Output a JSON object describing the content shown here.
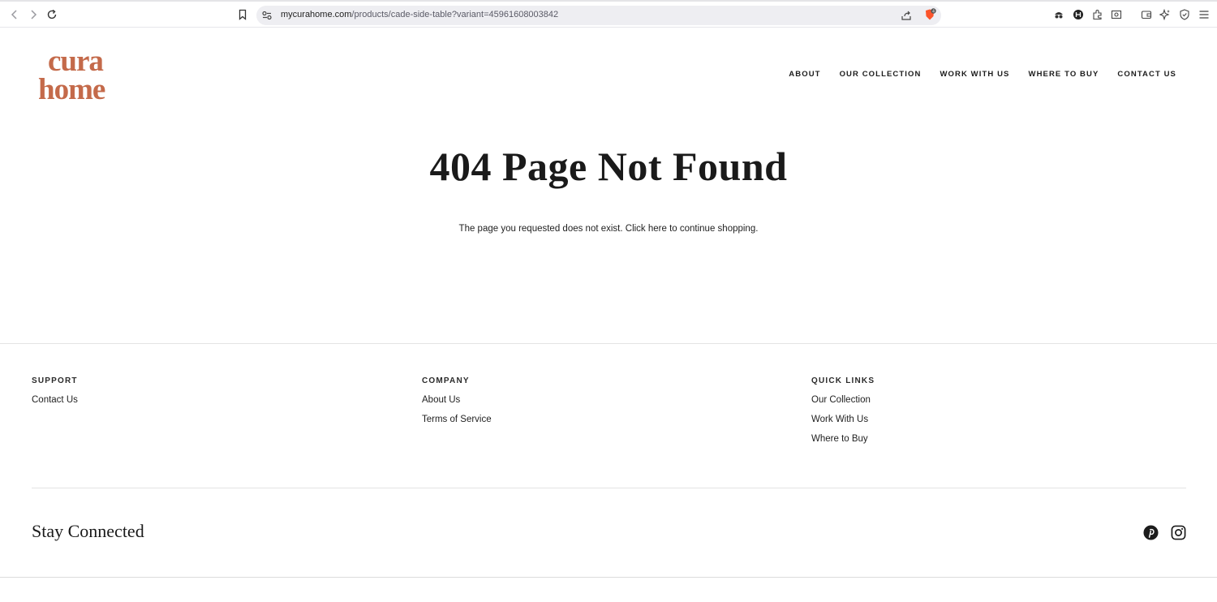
{
  "browser": {
    "url_host": "mycurahome.com",
    "url_path": "/products/cade-side-table?variant=45961608003842",
    "shields_badge": "4"
  },
  "header": {
    "logo_alt": "cura home",
    "nav": [
      "ABOUT",
      "OUR COLLECTION",
      "WORK WITH US",
      "WHERE TO BUY",
      "CONTACT US"
    ]
  },
  "main": {
    "title": "404 Page Not Found",
    "message": "The page you requested does not exist. Click here to continue shopping."
  },
  "footer": {
    "columns": [
      {
        "heading": "SUPPORT",
        "links": [
          "Contact Us"
        ]
      },
      {
        "heading": "COMPANY",
        "links": [
          "About Us",
          "Terms of Service"
        ]
      },
      {
        "heading": "QUICK LINKS",
        "links": [
          "Our Collection",
          "Work With Us",
          "Where to Buy"
        ]
      }
    ],
    "stay_connected": "Stay Connected",
    "social": [
      "pinterest-icon",
      "instagram-icon"
    ]
  },
  "colors": {
    "brand": "#c46a4a",
    "text": "#1c1c1c",
    "rule": "#e3e3e3"
  }
}
